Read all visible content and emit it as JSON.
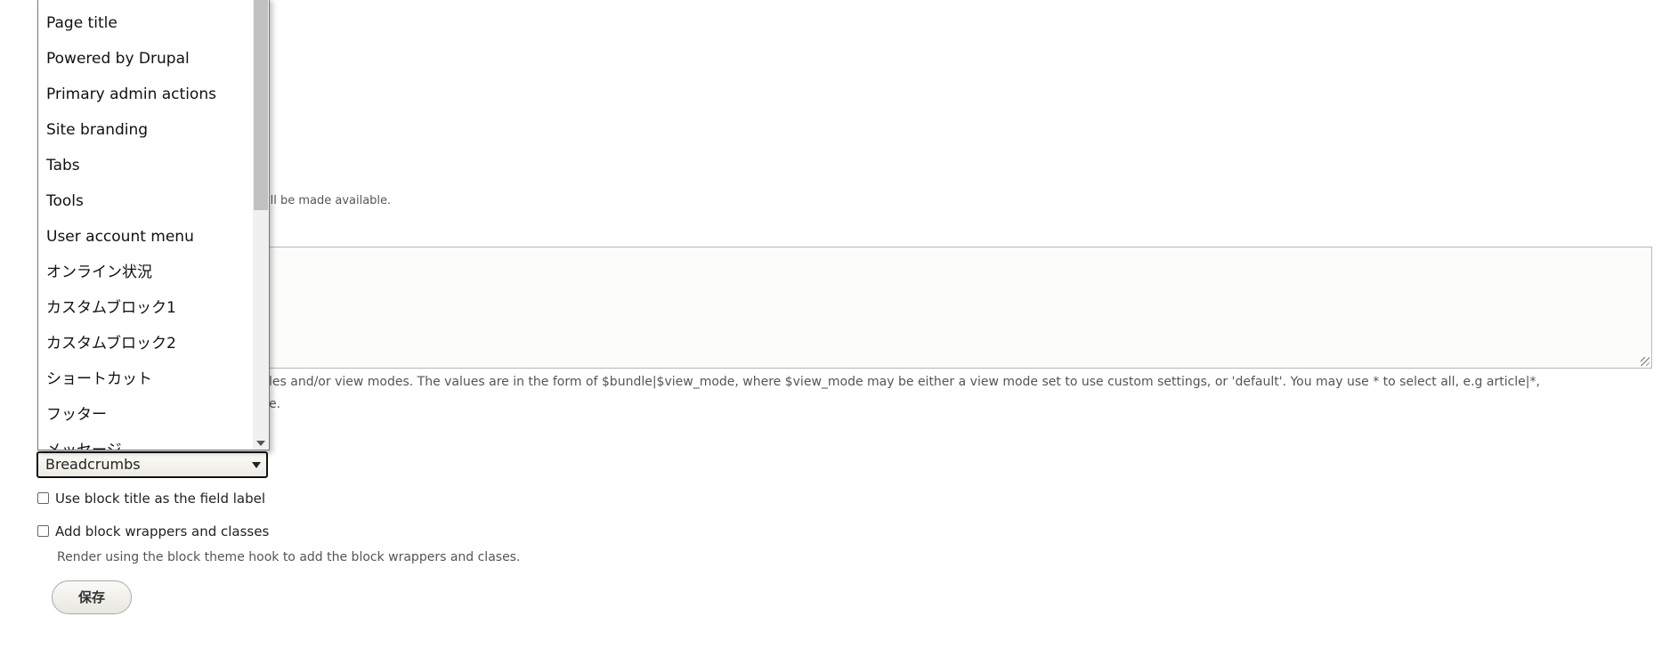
{
  "description_top": "ill be made available.",
  "textarea": {
    "value": ""
  },
  "description_bundle": {
    "line1": "les and/or view modes. The values are in the form of $bundle|$view_mode, where $view_mode may be either a view mode set to use custom settings, or 'default'. You may use * to select all, e.g article|*,",
    "line2": "e."
  },
  "dropdown": {
    "options": [
      "Page title",
      "Powered by Drupal",
      "Primary admin actions",
      "Site branding",
      "Tabs",
      "Tools",
      "User account menu",
      "オンライン状況",
      "カスタムブロック1",
      "カスタムブロック2",
      "ショートカット",
      "フッター",
      "メッセージ"
    ]
  },
  "select": {
    "value": "Breadcrumbs"
  },
  "checkboxes": [
    {
      "label": "Use block title as the field label",
      "checked": false
    },
    {
      "label": "Add block wrappers and classes",
      "checked": false,
      "description": "Render using the block theme hook to add the block wrappers and clases."
    }
  ],
  "save_button": {
    "label": "保存"
  }
}
